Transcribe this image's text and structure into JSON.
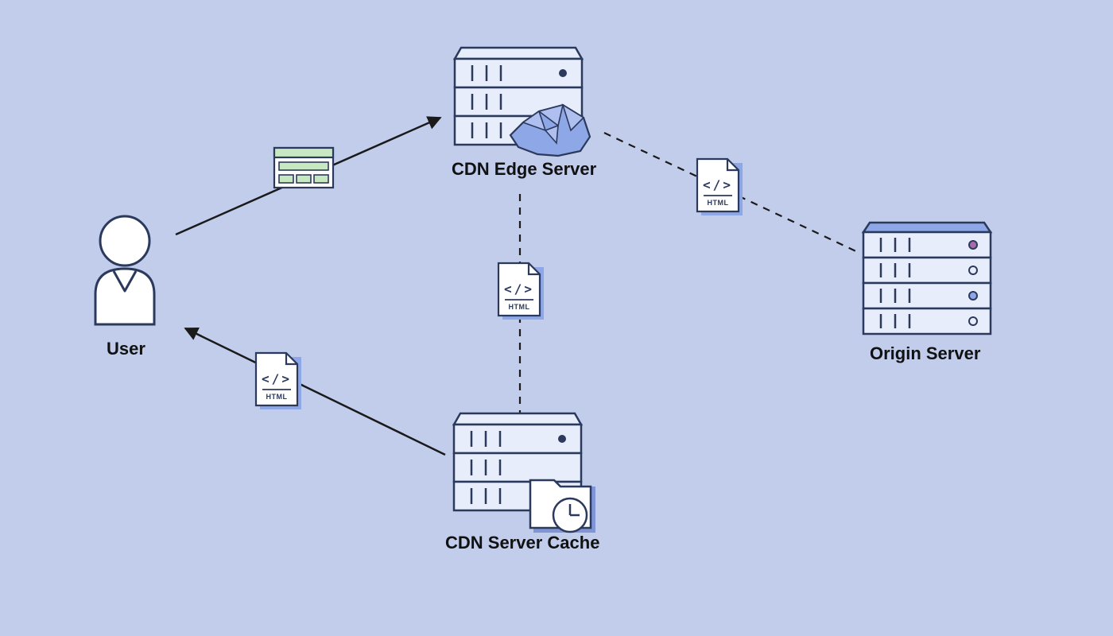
{
  "nodes": {
    "user": {
      "label": "User"
    },
    "edge_server": {
      "label": "CDN Edge Server"
    },
    "cache": {
      "label": "CDN Server Cache"
    },
    "origin": {
      "label": "Origin Server"
    }
  },
  "edge_icons": {
    "html_file": {
      "badge": "HTML",
      "code": "</>"
    }
  },
  "edges": [
    {
      "from": "user",
      "to": "edge_server",
      "style": "solid",
      "icon": "browser",
      "direction": "to"
    },
    {
      "from": "edge_server",
      "to": "origin",
      "style": "dashed",
      "icon": "html_file",
      "direction": "none"
    },
    {
      "from": "edge_server",
      "to": "cache",
      "style": "dashed",
      "icon": "html_file",
      "direction": "none"
    },
    {
      "from": "cache",
      "to": "user",
      "style": "solid",
      "icon": "html_file",
      "direction": "to"
    }
  ]
}
